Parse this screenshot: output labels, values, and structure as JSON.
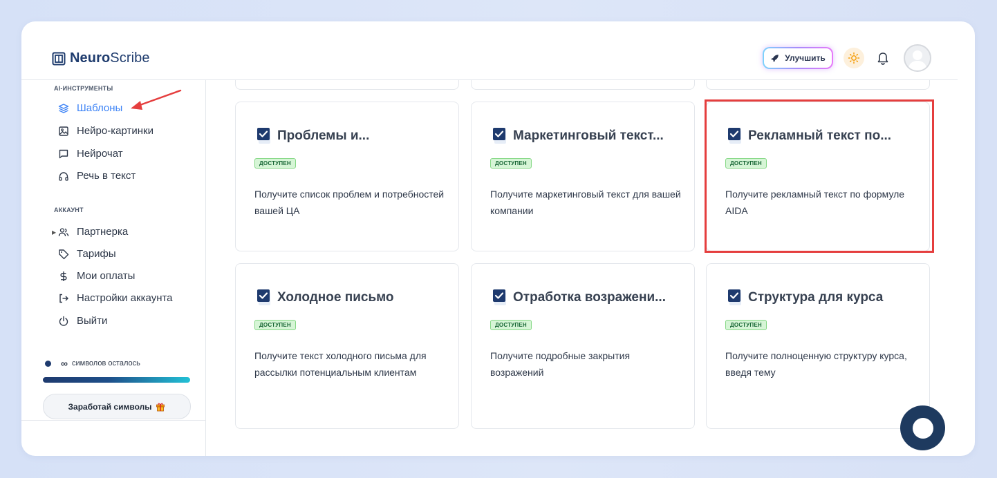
{
  "app": {
    "logo_bold": "Neuro",
    "logo_rest": "Scribe"
  },
  "header": {
    "upgrade_label": "Улучшить",
    "icons": [
      "rocket-icon",
      "sun-icon",
      "bell-icon",
      "avatar"
    ]
  },
  "sidebar": {
    "ai_section_title": "AI-ИНСТРУМЕНТЫ",
    "ai_items": [
      {
        "label": "Шаблоны",
        "icon": "layers-icon",
        "active": true
      },
      {
        "label": "Нейро-картинки",
        "icon": "image-icon"
      },
      {
        "label": "Нейрочат",
        "icon": "chat-icon"
      },
      {
        "label": "Речь в текст",
        "icon": "headphones-icon"
      }
    ],
    "account_section_title": "АККАУНТ",
    "account_items": [
      {
        "label": "Партнерка",
        "icon": "users-icon"
      },
      {
        "label": "Тарифы",
        "icon": "tag-icon"
      },
      {
        "label": "Мои оплаты",
        "icon": "dollar-icon"
      },
      {
        "label": "Настройки аккаунта",
        "icon": "login-icon"
      },
      {
        "label": "Выйти",
        "icon": "power-icon"
      }
    ],
    "symbols_value": "∞",
    "symbols_label": "символов осталось",
    "earn_label": "Заработай символы",
    "earn_icon": "gift-icon"
  },
  "cards": [
    {
      "title": "Проблемы и...",
      "badge": "ДОСТУПЕН",
      "desc": "Получите список проблем и потребностей вашей ЦА"
    },
    {
      "title": "Маркетинговый текст...",
      "badge": "ДОСТУПЕН",
      "desc": "Получите маркетинговый текст для вашей компании"
    },
    {
      "title": "Рекламный текст по...",
      "badge": "ДОСТУПЕН",
      "desc": "Получите рекламный текст по формуле AIDA",
      "highlighted": true
    },
    {
      "title": "Холодное письмо",
      "badge": "ДОСТУПЕН",
      "desc": "Получите текст холодного письма для рассылки потенциальным клиентам"
    },
    {
      "title": "Отработка возражени...",
      "badge": "ДОСТУПЕН",
      "desc": "Получите подробные закрытия возражений"
    },
    {
      "title": "Структура для курса",
      "badge": "ДОСТУПЕН",
      "desc": "Получите полноценную структуру курса, введя тему"
    }
  ],
  "colors": {
    "accent": "#3b82f6",
    "brand": "#1f3c6e",
    "highlight": "#e53e3e",
    "badge_bg": "#d6f5d6",
    "annotation_arrow": "#e53e3e"
  }
}
